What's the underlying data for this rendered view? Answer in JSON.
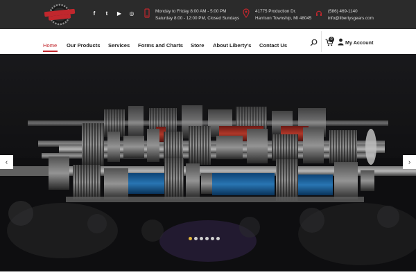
{
  "brand": {
    "logo_text": "LIBERTY'S GEARS"
  },
  "social": [
    {
      "icon": "facebook-icon",
      "glyph": "f"
    },
    {
      "icon": "twitter-icon",
      "glyph": "t"
    },
    {
      "icon": "youtube-icon",
      "glyph": "▶"
    },
    {
      "icon": "instagram-icon",
      "glyph": "◎"
    }
  ],
  "contact": {
    "hours_line1": "Monday to Friday 8:00 AM - 5:00 PM",
    "hours_line2": "Saturday 8:00 - 12:00 PM, Closed Sundays",
    "address_line1": "41775 Production Dr.",
    "address_line2": "Harrison Township, MI 48045",
    "phone": "(586) 469-1140",
    "email": "info@libertysgears.com"
  },
  "nav": {
    "items": [
      {
        "label": "Home",
        "active": true
      },
      {
        "label": "Our Products"
      },
      {
        "label": "Services"
      },
      {
        "label": "Forms and Charts"
      },
      {
        "label": "Store"
      },
      {
        "label": "About Liberty's"
      },
      {
        "label": "Contact Us"
      }
    ],
    "cart_count": "0",
    "account_label": "My Account"
  },
  "slider": {
    "prev_glyph": "‹",
    "next_glyph": "›",
    "slide_count": 6,
    "active_index": 0
  },
  "colors": {
    "accent": "#c1272d",
    "topbar": "#2b2b2b",
    "active_dot": "#e3b63a",
    "gear_blue": "#1f6fb2",
    "gear_red": "#b8322a"
  }
}
